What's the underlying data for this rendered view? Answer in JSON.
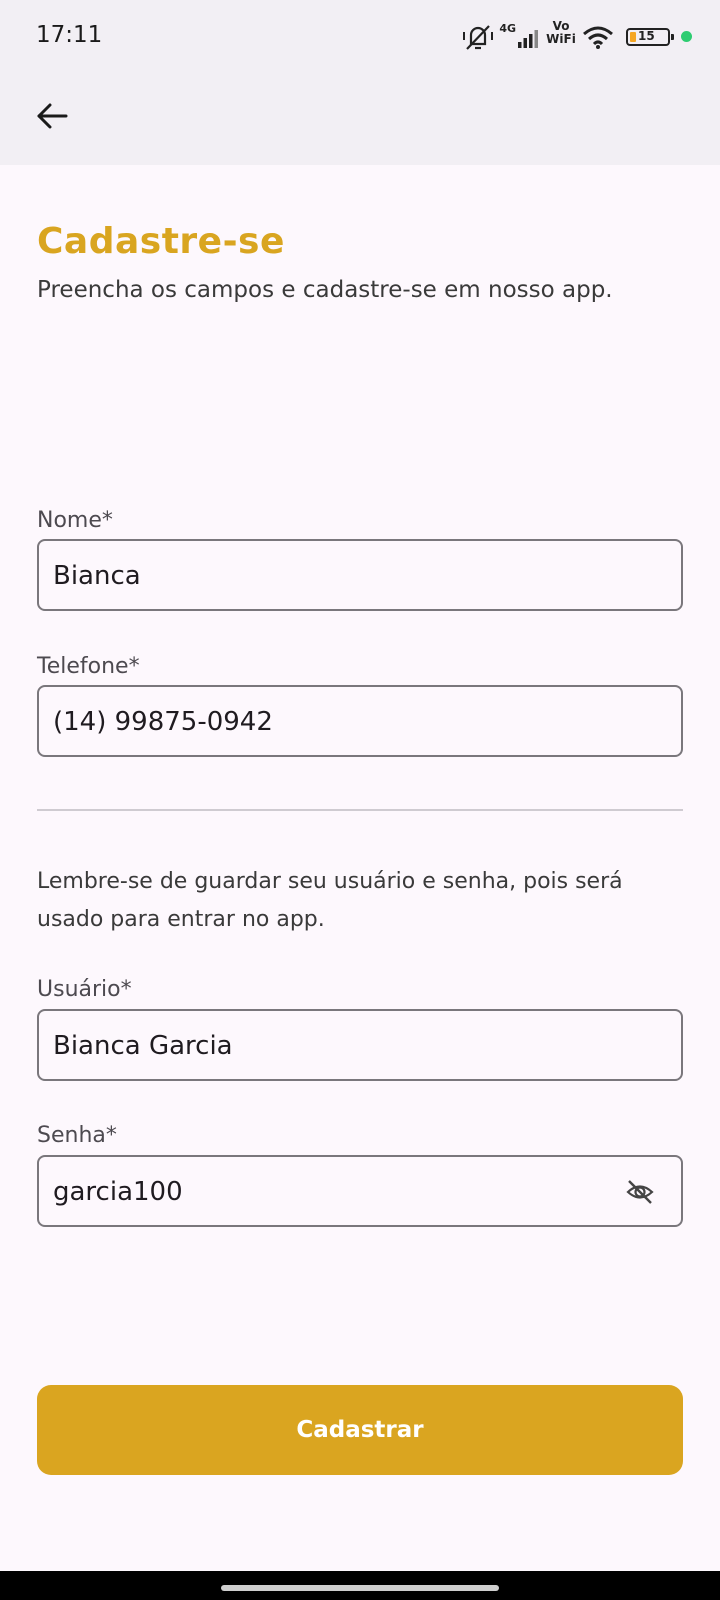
{
  "status_bar": {
    "time": "17:11",
    "network": "4G",
    "vowifi_top": "Vo",
    "vowifi_bottom": "WiFi",
    "battery": "15",
    "battery_color": "#f5a623",
    "dot_color": "#2ecc71",
    "icons": [
      "mute-vibrate-icon",
      "signal-icon",
      "vowifi-icon",
      "wifi-icon",
      "battery-icon"
    ]
  },
  "app_bar": {
    "back_icon": "arrow-left-icon"
  },
  "header": {
    "title": "Cadastre-se",
    "subtitle": "Preencha os campos e cadastre-se em nosso app."
  },
  "form": {
    "name": {
      "label": "Nome*",
      "value": "Bianca"
    },
    "phone": {
      "label": "Telefone*",
      "value": "(14) 99875-0942"
    },
    "note": "Lembre-se de guardar seu usuário e senha, pois será usado para entrar no app.",
    "username": {
      "label": "Usuário*",
      "value": "Bianca Garcia"
    },
    "password": {
      "label": "Senha*",
      "value": "garcia100",
      "toggle_icon": "eye-off-icon"
    }
  },
  "submit": {
    "label": "Cadastrar"
  },
  "colors": {
    "accent": "#daa520",
    "title": "#d9a520",
    "background": "#fdf8fd",
    "app_bar": "#f2eff4"
  }
}
